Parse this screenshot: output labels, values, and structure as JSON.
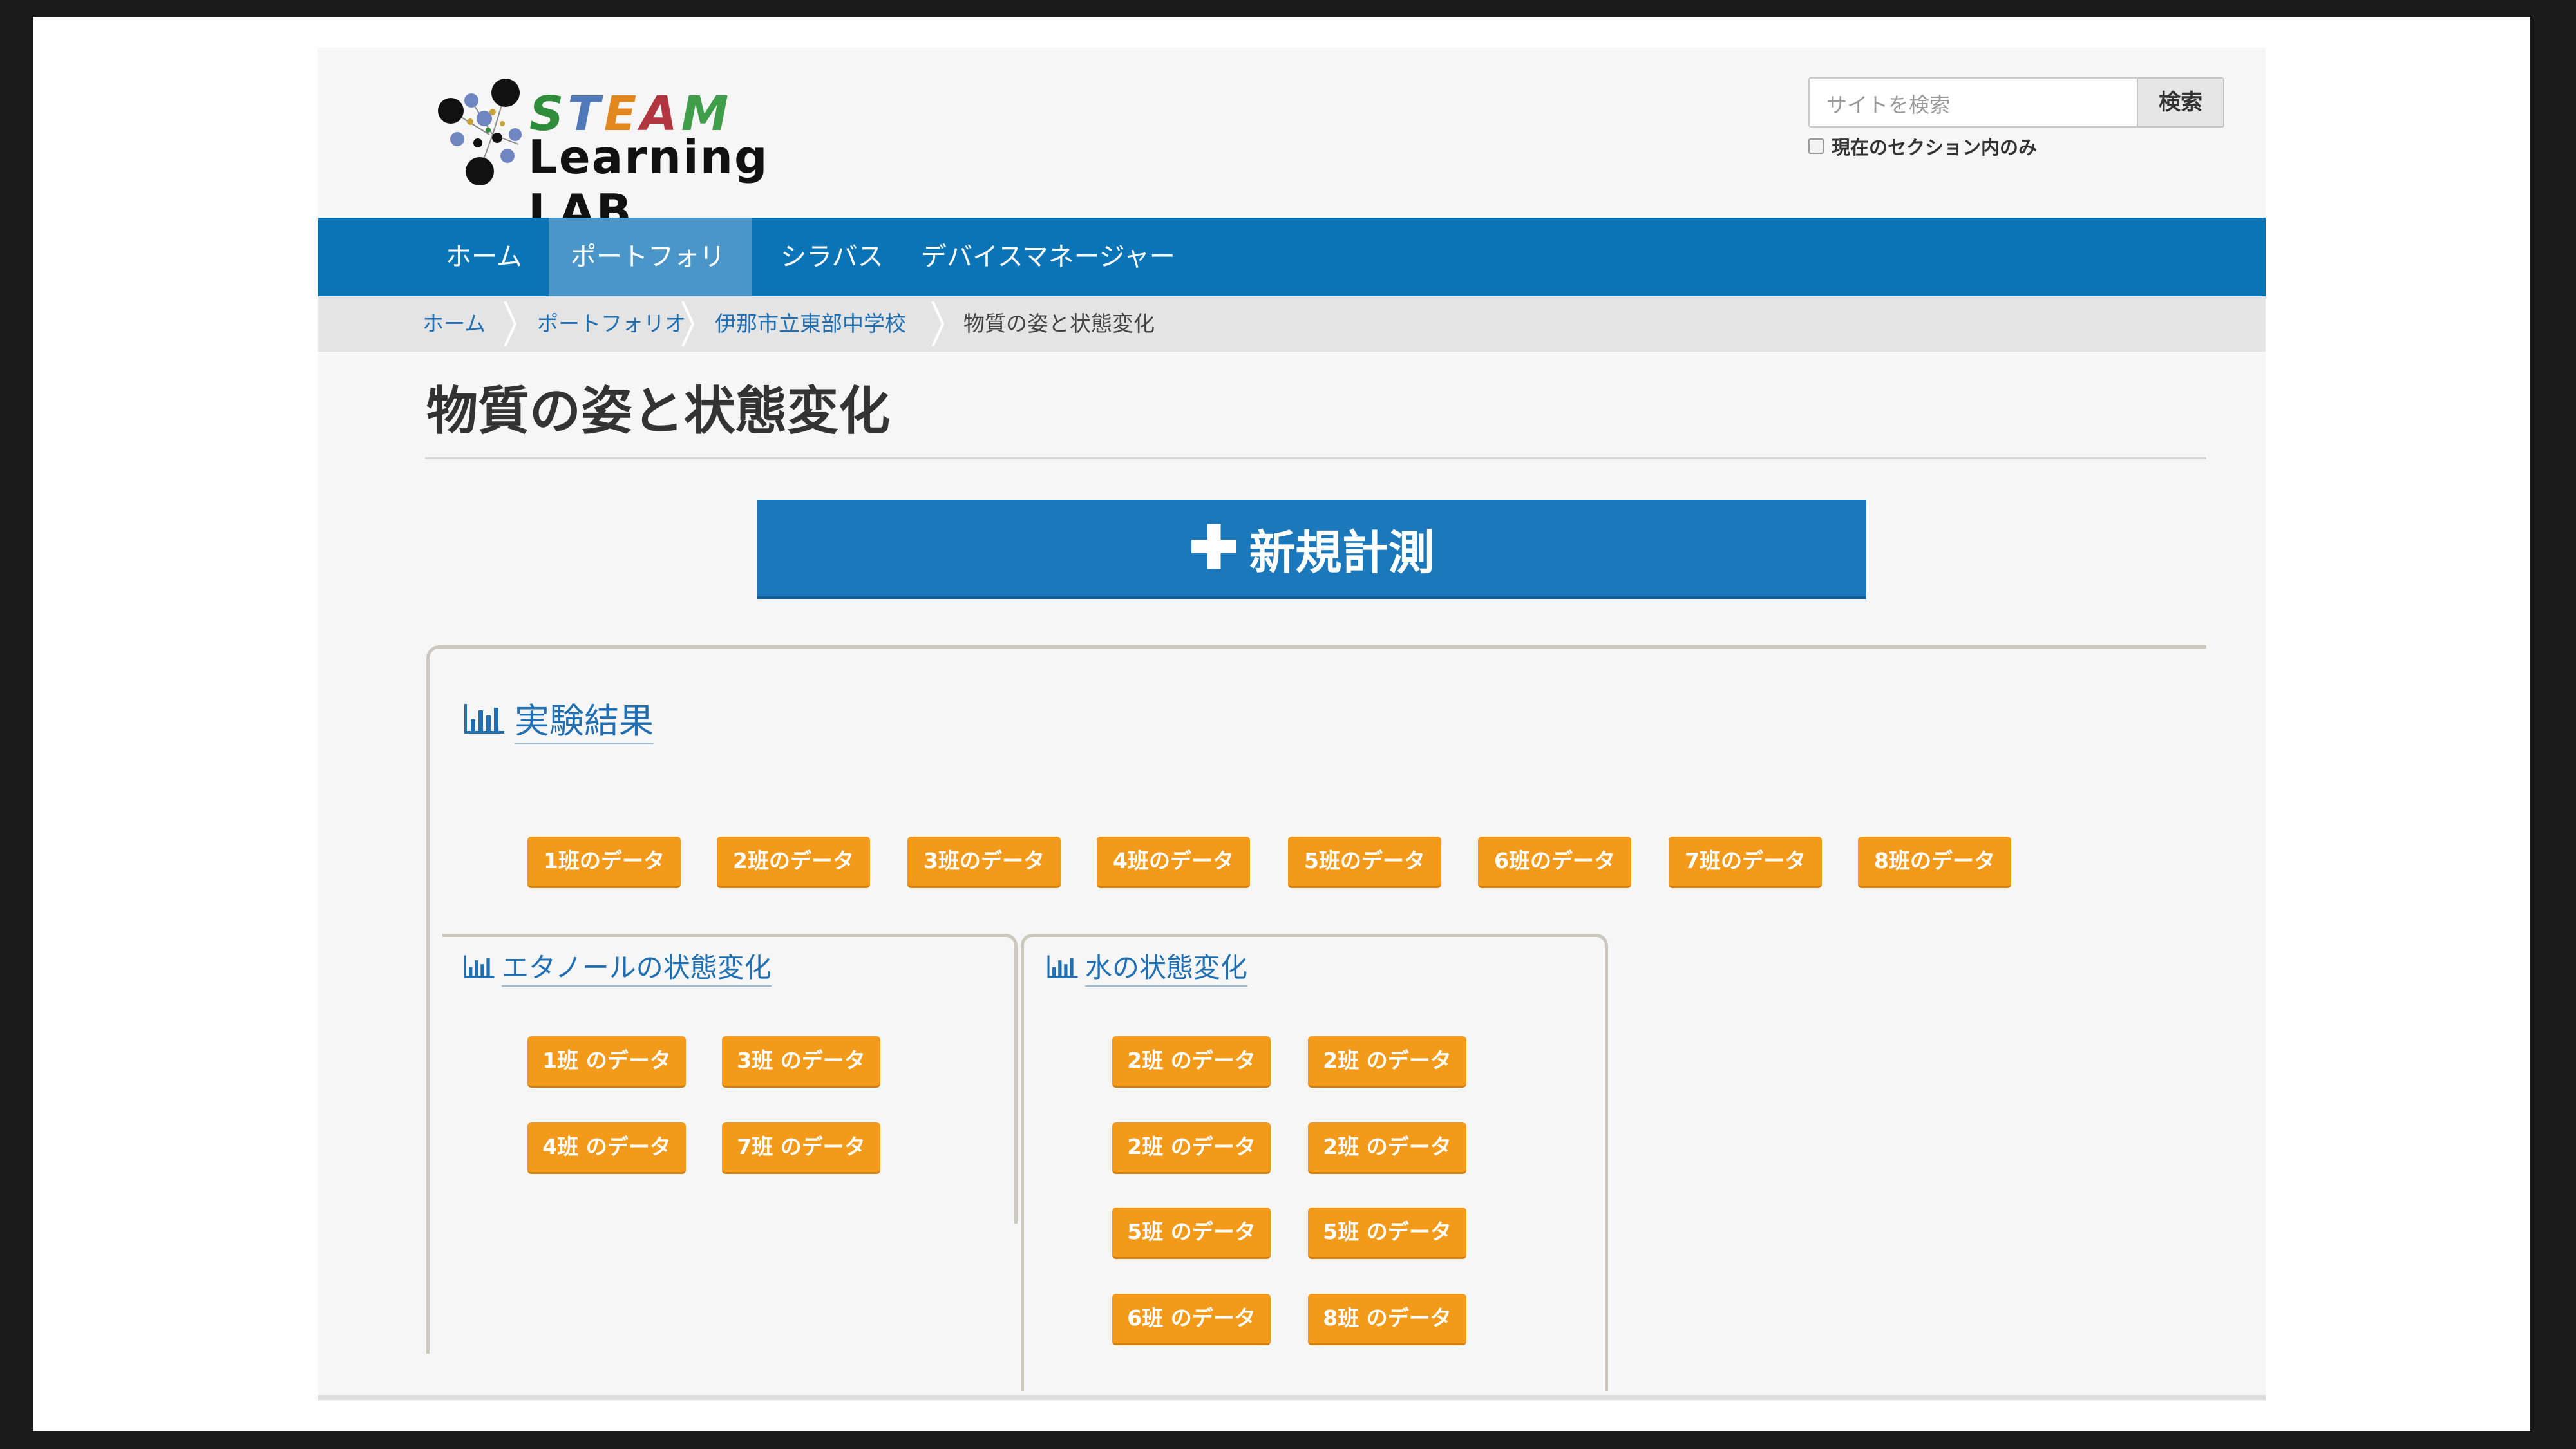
{
  "header": {
    "logo": {
      "word1": [
        "S",
        "T",
        "E",
        "A",
        "M"
      ],
      "word1_colors": [
        "#2f8c3b",
        "#4f79b8",
        "#e1871d",
        "#b23640",
        "#3f9e4a"
      ],
      "word2": "Learning LAB"
    },
    "search_placeholder": "サイトを検索",
    "search_button": "検索",
    "section_only_label": "現在のセクション内のみ"
  },
  "nav": {
    "items": [
      "ホーム",
      "ポートフォリオ",
      "シラバス",
      "デバイスマネージャー"
    ],
    "active": "ポートフォリオ"
  },
  "breadcrumb": [
    "ホーム",
    "ポートフォリオ",
    "伊那市立東部中学校",
    "物質の姿と状態変化"
  ],
  "page_title": "物質の姿と状態変化",
  "new_button_label": "新規計測",
  "results": {
    "title": "実験結果",
    "buttons": [
      "1班のデータ",
      "2班のデータ",
      "3班のデータ",
      "4班のデータ",
      "5班のデータ",
      "6班のデータ",
      "7班のデータ",
      "8班のデータ"
    ],
    "ethanol": {
      "title": "エタノールの状態変化",
      "buttons": [
        "1班 のデータ",
        "3班 のデータ",
        "4班 のデータ",
        "7班 のデータ"
      ]
    },
    "water": {
      "title": "水の状態変化",
      "buttons": [
        "2班 のデータ",
        "2班 のデータ",
        "2班 のデータ",
        "2班 のデータ",
        "5班 のデータ",
        "5班 のデータ",
        "6班 のデータ",
        "8班 のデータ"
      ]
    }
  },
  "colors": {
    "nav": "#0a74b6",
    "nav_active": "#4b96c8",
    "primary_button": "#1b78bb",
    "data_button": "#f39a1b",
    "link": "#1f6fb2"
  }
}
